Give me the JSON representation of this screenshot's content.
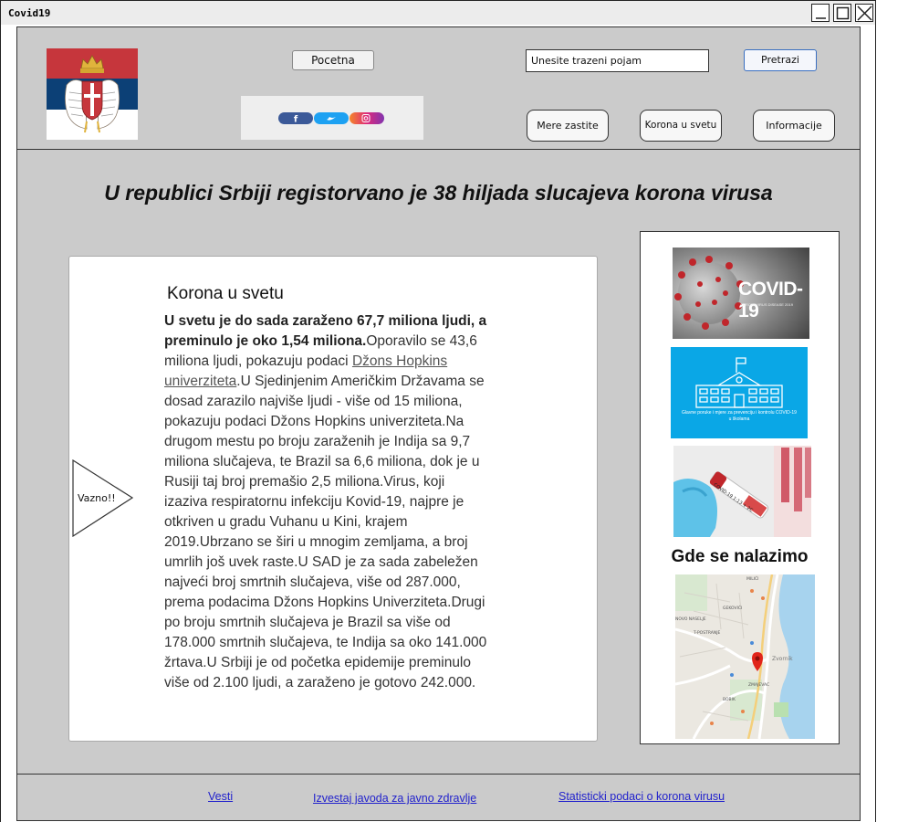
{
  "window": {
    "title": "Covid19"
  },
  "header": {
    "home_label": "Pocetna",
    "search_value": "Unesite trazeni pojam",
    "search_button": "Pretrazi",
    "nav": [
      {
        "label": "Mere zastite"
      },
      {
        "label": "Korona u svetu"
      },
      {
        "label": "Informacije"
      }
    ],
    "social_icons": [
      "facebook-icon",
      "twitter-icon",
      "instagram-icon"
    ]
  },
  "headline": "U republici Srbiji registorvano je 38 hiljada slucajeva korona virusa",
  "article": {
    "title": "Korona u svetu",
    "bold_intro": "U svetu je do sada zaraženo 67,7 miliona ljudi, a preminulo je oko 1,54 miliona.",
    "text_before_link": "Oporavilo se 43,6 miliona ljudi, pokazuju podaci ",
    "link_text": "Džons Hopkins univerziteta",
    "text_after_link": ".U Sjedinjenim Američkim Državama se dosad zarazilo najviše ljudi - više od 15 miliona, pokazuju podaci Džons Hopkins univerziteta.Na drugom mestu po broju zaraženih je Indija sa 9,7 miliona slučajeva, te Brazil sa 6,6 miliona, dok je u Rusiji taj broj premašio 2,5 miliona.Virus, koji izaziva respiratornu infekciju Kovid-19, najpre je otkriven u gradu Vuhanu u Kini, krajem 2019.Ubrzano se širi u mnogim zemljama, a broj umrlih još uvek raste.U SAD je za sada zabeležen najveći broj smrtnih slučajeva, više od 287.000, prema podacima Džons Hopkins Univerziteta.Drugi po broju smrtnih slučajeva je Brazil sa više od 178.000 smrtnih slučajeva, te Indija sa oko 141.000 žrtava.U Srbiji je od početka epidemije preminulo više od 2.100 ljudi, a zaraženo je gotovo 242.000."
  },
  "callout": {
    "label": "Vazno!!"
  },
  "sidebar": {
    "covid_image_text": "COVID-19",
    "covid_image_subtext": "CORONAVIRUS DISEASE 2019",
    "school_image_text": "Glavne poruke i mjere za prevenciju i kontrolu COVID-19 u školama",
    "test_image_text": "COVID-19 1:13 + 2C",
    "location_title": "Gde se nalazimo",
    "map_labels": [
      "MILIĆI",
      "GEKOVIĆI",
      "NOVO NASELJE",
      "T-POSTRANJE",
      "Zvornik",
      "ZMAJEVAC",
      "BOBIK"
    ]
  },
  "footer": {
    "links": [
      {
        "label": "Vesti"
      },
      {
        "label": "Izvestaj javoda za javno zdravlje"
      },
      {
        "label": "Statisticki podaci o korona virusu"
      }
    ]
  },
  "colors": {
    "frame_gray": "#cbcbcb",
    "link_blue": "#2222cc",
    "flag_red": "#c6363c",
    "flag_blue": "#0c4076",
    "school_blue": "#0aa7e6"
  }
}
